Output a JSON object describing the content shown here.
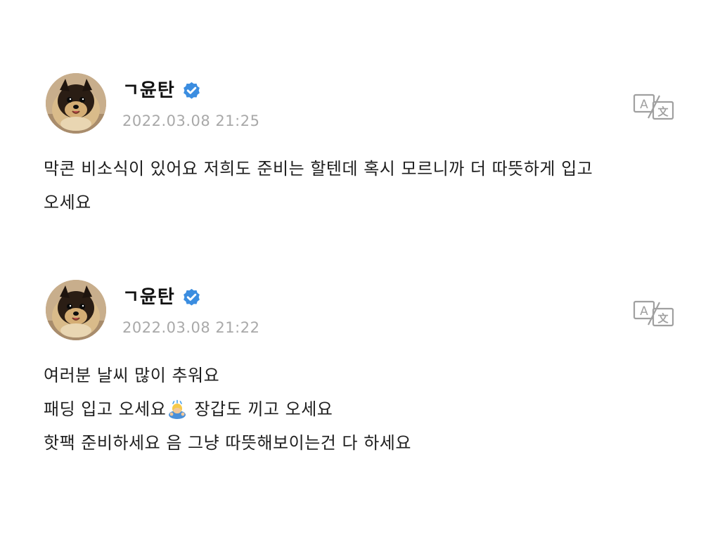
{
  "posts": [
    {
      "author": "ㄱ윤탄",
      "timestamp": "2022.03.08 21:25",
      "verified_icon": "verified-badge-icon",
      "translate_icon": "translate-icon",
      "body_lines": [
        "막콘 비소식이 있어요 저희도 준비는 할텐데 혹시 모르니까 더 따뜻하게 입고",
        "오세요"
      ]
    },
    {
      "author": "ㄱ윤탄",
      "timestamp": "2022.03.08 21:22",
      "verified_icon": "verified-badge-icon",
      "translate_icon": "translate-icon",
      "body_lines": [
        "여러분 날씨 많이 추워요",
        "패딩 입고 오세요",
        " 장갑도 끼고 오세요",
        "핫팩 준비하세요 음 그냥 따뜻해보이는건 다 하세요"
      ],
      "emoji": "bow-emoji-icon"
    }
  ],
  "colors": {
    "verified": "#3b8de0",
    "timestamp": "#a9a9a9",
    "text": "#1e1e1e",
    "translate_icon": "#a0a0a0"
  }
}
